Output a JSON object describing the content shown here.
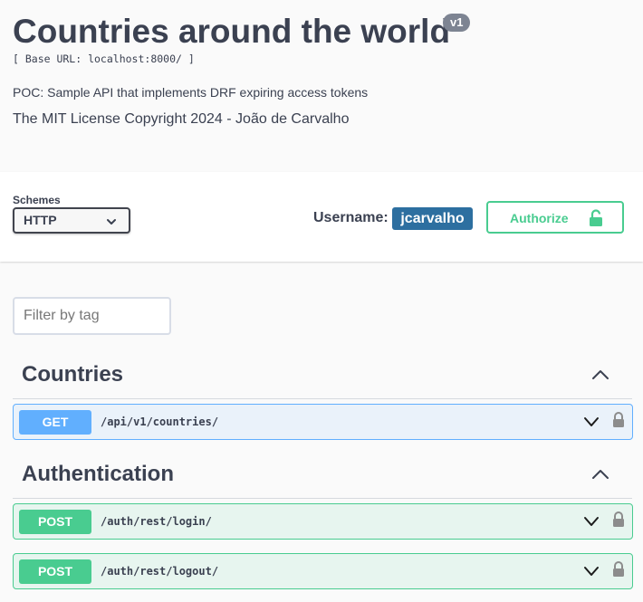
{
  "info": {
    "title": "Countries around the world",
    "version": "v1",
    "base_url": "[ Base URL: localhost:8000/ ]",
    "description": "POC: Sample API that implements DRF expiring access tokens",
    "license": "The MIT License Copyright 2024 - João de Carvalho"
  },
  "scheme_bar": {
    "schemes_label": "Schemes",
    "scheme_value": "HTTP",
    "username_label": "Username:",
    "username": "jcarvalho",
    "authorize_label": "Authorize"
  },
  "filter": {
    "placeholder": "Filter by tag"
  },
  "tags": [
    {
      "name": "Countries",
      "operations": [
        {
          "method": "GET",
          "path": "/api/v1/countries/"
        }
      ]
    },
    {
      "name": "Authentication",
      "operations": [
        {
          "method": "POST",
          "path": "/auth/rest/login/"
        },
        {
          "method": "POST",
          "path": "/auth/rest/logout/"
        }
      ]
    }
  ],
  "colors": {
    "get": "#61affe",
    "post": "#49cc90",
    "username_badge": "#2d6fa0",
    "version_badge": "#7d8492",
    "text": "#3b4151"
  },
  "icons": [
    "chevron-down-icon",
    "chevron-up-icon",
    "lock-icon",
    "unlock-icon"
  ]
}
